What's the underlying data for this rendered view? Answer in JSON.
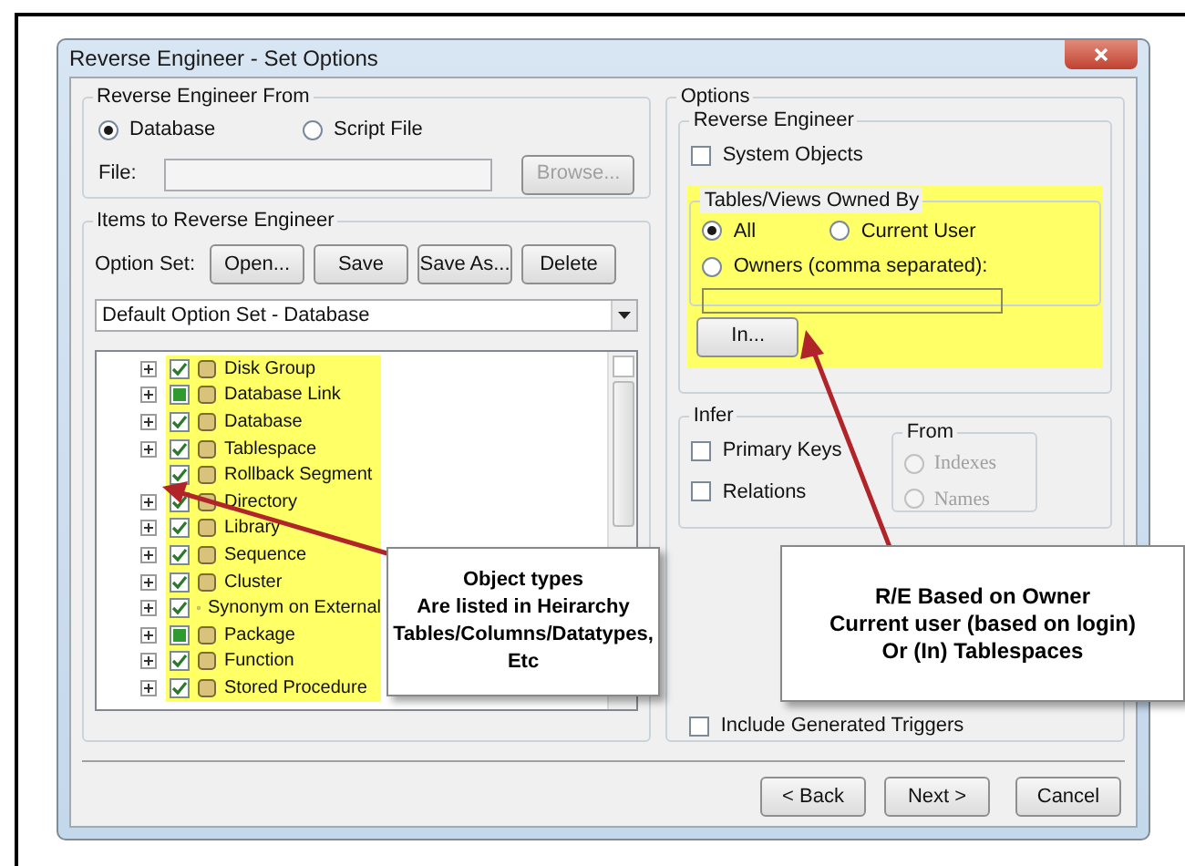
{
  "window": {
    "title": "Reverse Engineer - Set Options"
  },
  "source": {
    "label": "Reverse Engineer From",
    "options": [
      {
        "label": "Database",
        "selected": true
      },
      {
        "label": "Script File",
        "selected": false
      }
    ],
    "file_label": "File:",
    "browse_button": {
      "label": "Browse...",
      "disabled": true
    }
  },
  "items": {
    "label": "Items to Reverse Engineer",
    "option_set_label": "Option Set:",
    "buttons": [
      "Open...",
      "Save",
      "Save As...",
      "Delete"
    ],
    "dropdown_value": "Default Option Set - Database",
    "tree": [
      {
        "label": "Disk Group",
        "checked": true,
        "partial": false,
        "expandable": true
      },
      {
        "label": "Database Link",
        "checked": false,
        "partial": true,
        "expandable": true
      },
      {
        "label": "Database",
        "checked": true,
        "partial": false,
        "expandable": true
      },
      {
        "label": "Tablespace",
        "checked": true,
        "partial": false,
        "expandable": true
      },
      {
        "label": "Rollback Segment",
        "checked": true,
        "partial": false,
        "expandable": false
      },
      {
        "label": "Directory",
        "checked": true,
        "partial": false,
        "expandable": true
      },
      {
        "label": "Library",
        "checked": true,
        "partial": false,
        "expandable": true
      },
      {
        "label": "Sequence",
        "checked": true,
        "partial": false,
        "expandable": true
      },
      {
        "label": "Cluster",
        "checked": true,
        "partial": false,
        "expandable": true
      },
      {
        "label": "Synonym on External",
        "checked": true,
        "partial": false,
        "expandable": true
      },
      {
        "label": "Package",
        "checked": false,
        "partial": true,
        "expandable": true
      },
      {
        "label": "Function",
        "checked": true,
        "partial": false,
        "expandable": true
      },
      {
        "label": "Stored Procedure",
        "checked": true,
        "partial": false,
        "expandable": true
      }
    ]
  },
  "options": {
    "label": "Options",
    "reverse_engineer": {
      "label": "Reverse Engineer",
      "system_objects": {
        "label": "System Objects",
        "checked": false
      },
      "owned_by": {
        "label": "Tables/Views Owned By",
        "choices": [
          {
            "label": "All",
            "selected": true
          },
          {
            "label": "Current User",
            "selected": false
          },
          {
            "label": "Owners (comma separated):",
            "selected": false
          }
        ]
      },
      "in_button": "In..."
    },
    "infer": {
      "label": "Infer",
      "checks": [
        {
          "label": "Primary Keys",
          "checked": false
        },
        {
          "label": "Relations",
          "checked": false
        }
      ],
      "from": {
        "label": "From",
        "choices": [
          {
            "label": "Indexes",
            "selected": false,
            "disabled": true
          },
          {
            "label": "Names",
            "selected": false,
            "disabled": true
          }
        ]
      }
    },
    "generated_triggers": {
      "label": "Include Generated Triggers",
      "checked": false
    }
  },
  "footer_buttons": [
    "< Back",
    "Next >",
    "Cancel"
  ],
  "callouts": [
    {
      "lines": [
        "Object types",
        "Are listed in Heirarchy",
        "Tables/Columns/Datatypes,",
        "Etc"
      ]
    },
    {
      "lines": [
        "R/E Based on Owner",
        "Current user (based on login)",
        "Or (In) Tablespaces"
      ]
    }
  ]
}
